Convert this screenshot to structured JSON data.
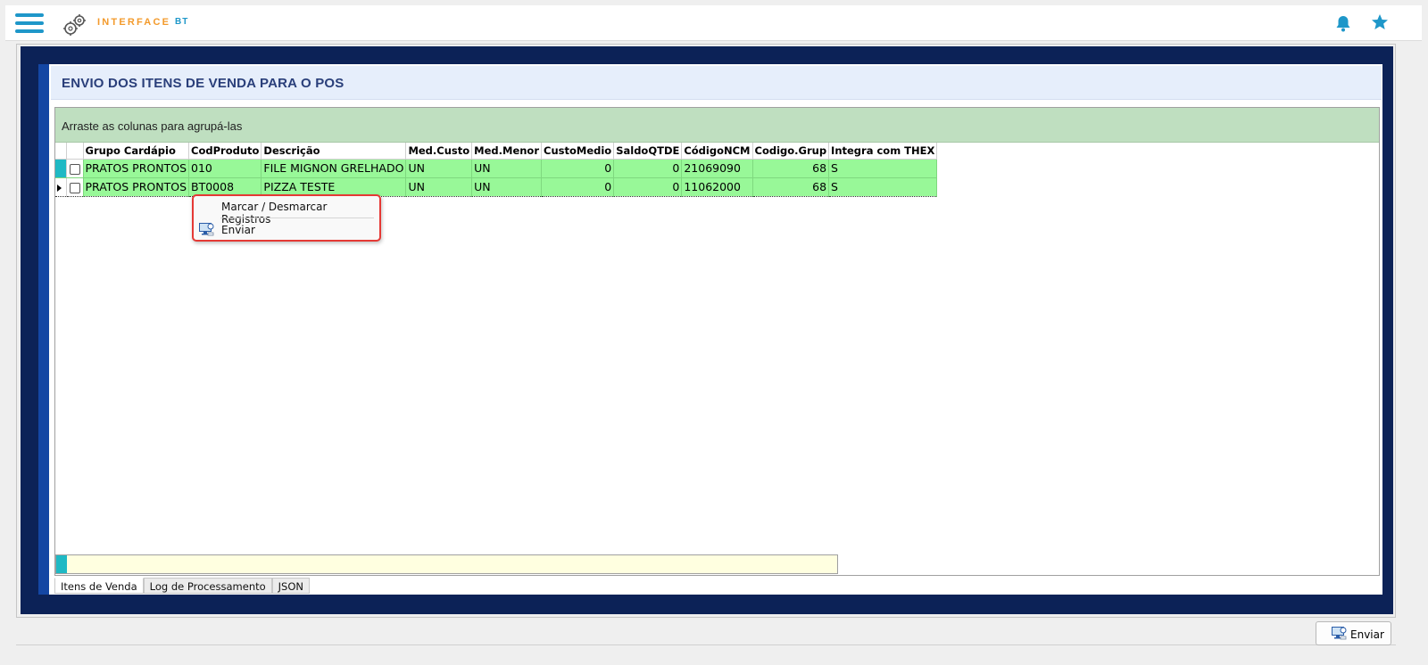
{
  "app": {
    "logo_text": "INTERFACE",
    "logo_suffix": "BT"
  },
  "icons": {
    "menu": "hamburger-icon",
    "logo": "gears-icon",
    "notifications": "bell-icon",
    "favorites": "star-icon",
    "send": "monitor-send-icon"
  },
  "colors": {
    "accent": "#1e97c9",
    "logo": "#f39a2b",
    "navy": "#0c2257",
    "row_fill": "#98f898",
    "group_panel": "#bfdfc0",
    "highlight": "#e53935"
  },
  "page": {
    "title": "ENVIO DOS ITENS DE VENDA PARA O POS"
  },
  "grid": {
    "group_hint": "Arraste as colunas para agrupá-las",
    "columns": [
      "Grupo Cardápio",
      "CodProduto",
      "Descrição",
      "Med.Custo",
      "Med.Menor",
      "CustoMedio",
      "SaldoQTDE",
      "CódigoNCM",
      "Codigo.Grup",
      "Integra com THEX"
    ],
    "rows": [
      {
        "grupo": "PRATOS PRONTOS",
        "cod": "010",
        "descricao": "FILE MIGNON GRELHADO",
        "med_custo": "UN",
        "med_menor": "UN",
        "custo_medio": "0",
        "saldo": "0",
        "ncm": "21069090",
        "cod_grup": "68",
        "integra": "S"
      },
      {
        "grupo": "PRATOS PRONTOS",
        "cod": "BT0008",
        "descricao": "PIZZA TESTE",
        "med_custo": "UN",
        "med_menor": "UN",
        "custo_medio": "0",
        "saldo": "0",
        "ncm": "11062000",
        "cod_grup": "68",
        "integra": "S"
      }
    ]
  },
  "context_menu": {
    "items": [
      "Marcar / Desmarcar Registros",
      "Enviar"
    ]
  },
  "tabs": [
    "Itens de Venda",
    "Log de Processamento",
    "JSON"
  ],
  "buttons": {
    "send": "Enviar"
  }
}
